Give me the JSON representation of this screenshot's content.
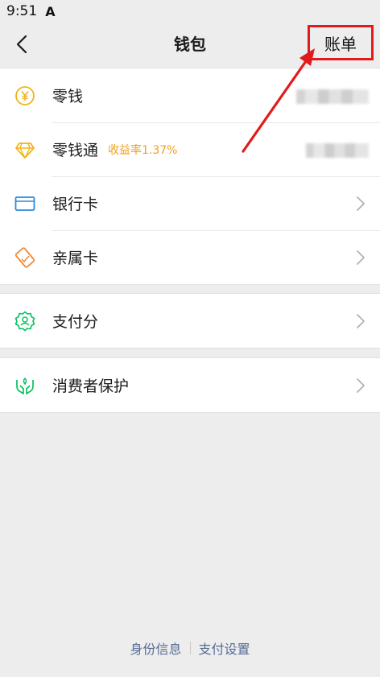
{
  "status_bar": {
    "time": "9:51",
    "indicator": "A"
  },
  "nav": {
    "title": "钱包",
    "bills_label": "账单",
    "back_icon": "chevron-left-icon"
  },
  "groups": {
    "funds": [
      {
        "label": "零钱",
        "icon": "yuan-coin-icon",
        "value_hidden": true
      },
      {
        "label": "零钱通",
        "sub_label": "收益率1.37%",
        "icon": "diamond-icon",
        "value_hidden": true
      },
      {
        "label": "银行卡",
        "icon": "bank-card-icon"
      },
      {
        "label": "亲属卡",
        "icon": "family-card-icon"
      }
    ],
    "credit": [
      {
        "label": "支付分",
        "icon": "pay-score-icon"
      }
    ],
    "protection": [
      {
        "label": "消费者保护",
        "icon": "consumer-protection-icon"
      }
    ]
  },
  "footer": {
    "identity_info": "身份信息",
    "payment_settings": "支付设置"
  },
  "colors": {
    "background": "#ededed",
    "annotation_red": "#e01b1b",
    "coin_yellow": "#f2b316",
    "card_blue": "#2a8cde",
    "family_orange": "#f08a3a",
    "green": "#07c160",
    "link_blue": "#576b95",
    "sub_label_orange": "#f0a020"
  }
}
